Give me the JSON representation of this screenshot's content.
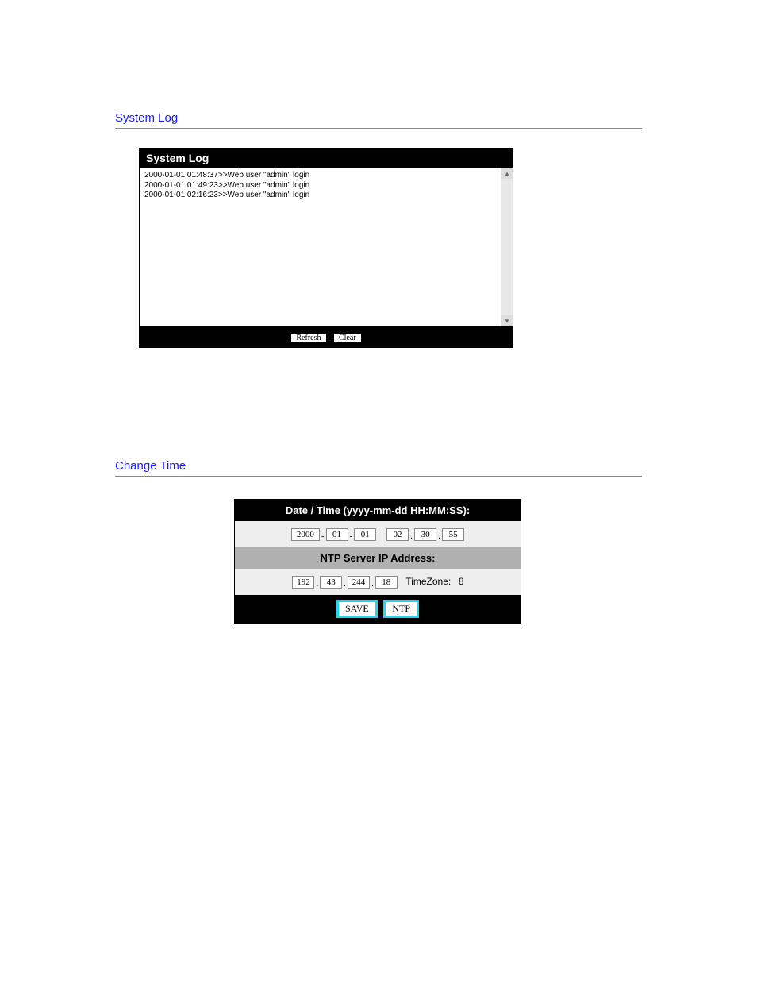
{
  "sections": {
    "system_log_title": "System Log",
    "change_time_title": "Change Time"
  },
  "syslog": {
    "header": "System Log",
    "entries": [
      "2000-01-01 01:48:37>>Web user \"admin\" login",
      "2000-01-01 01:49:23>>Web user \"admin\" login",
      "2000-01-01 02:16:23>>Web user \"admin\" login"
    ],
    "refresh_label": "Refresh",
    "clear_label": "Clear"
  },
  "time_panel": {
    "datetime_header": "Date / Time (yyyy-mm-dd HH:MM:SS):",
    "year": "2000",
    "month": "01",
    "day": "01",
    "hour": "02",
    "minute": "30",
    "second": "55",
    "ntp_header": "NTP Server IP Address:",
    "ip1": "192",
    "ip2": "43",
    "ip3": "244",
    "ip4": "18",
    "timezone_label": "TimeZone:",
    "timezone_value": "8",
    "save_label": "SAVE",
    "ntp_label": "NTP"
  }
}
